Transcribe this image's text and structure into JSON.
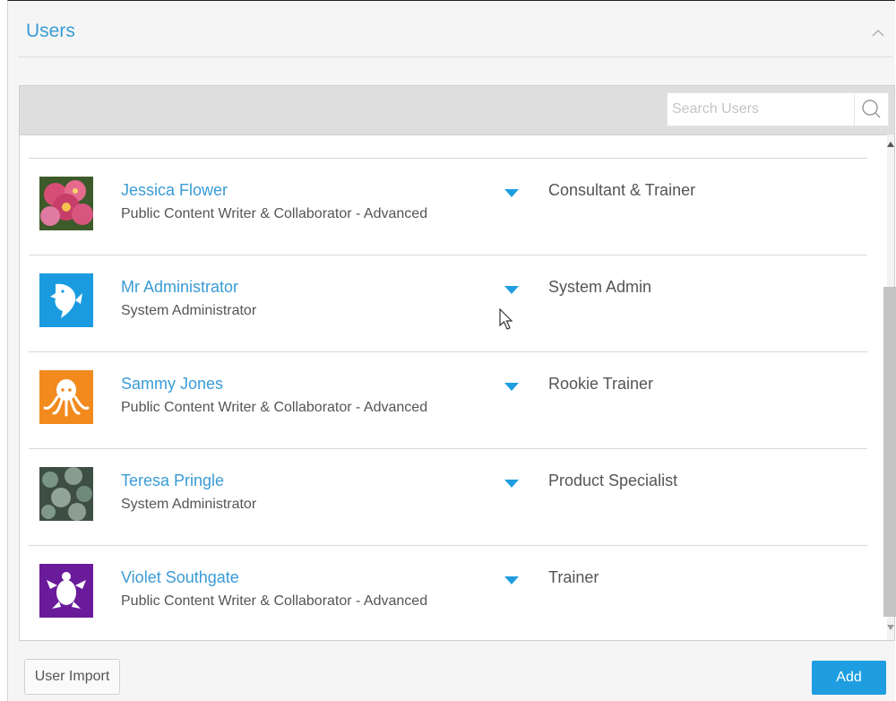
{
  "header": {
    "title": "Users"
  },
  "search": {
    "placeholder": "Search Users",
    "value": ""
  },
  "users": [
    {
      "name": "Jessica Flower",
      "role": "Public Content Writer & Collaborator - Advanced",
      "job_title": "Consultant & Trainer",
      "avatar": "flower-photo",
      "avatar_color": "#c94a6a"
    },
    {
      "name": "Mr Administrator",
      "role": "System Administrator",
      "job_title": "System Admin",
      "avatar": "shark-icon",
      "avatar_color": "#1a9be0"
    },
    {
      "name": "Sammy Jones",
      "role": "Public Content Writer & Collaborator - Advanced",
      "job_title": "Rookie Trainer",
      "avatar": "octopus-icon",
      "avatar_color": "#f28a1e"
    },
    {
      "name": "Teresa Pringle",
      "role": "System Administrator",
      "job_title": "Product Specialist",
      "avatar": "bokeh-photo",
      "avatar_color": "#6e8a7a"
    },
    {
      "name": "Violet Southgate",
      "role": "Public Content Writer & Collaborator - Advanced",
      "job_title": "Trainer",
      "avatar": "turtle-icon",
      "avatar_color": "#6a1b9a"
    }
  ],
  "footer": {
    "import_label": "User Import",
    "add_label": "Add"
  },
  "colors": {
    "accent": "#3a9bd5",
    "primary_button": "#1e9ee0"
  }
}
